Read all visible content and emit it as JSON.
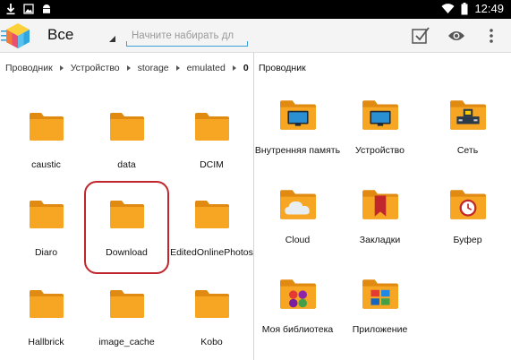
{
  "statusbar": {
    "time": "12:49",
    "left_icons": [
      "download-icon",
      "image-icon",
      "android-icon"
    ],
    "right_icons": [
      "wifi-icon",
      "battery-icon"
    ]
  },
  "actionbar": {
    "title": "Все",
    "search_placeholder": "Начните набирать дл",
    "actions": [
      "checkbox-icon",
      "eye-icon",
      "overflow-menu-icon"
    ]
  },
  "left_pane": {
    "breadcrumb": [
      "Проводник",
      "Устройство",
      "storage",
      "emulated",
      "0"
    ],
    "folders": [
      {
        "label": "caustic"
      },
      {
        "label": "data"
      },
      {
        "label": "DCIM"
      },
      {
        "label": "Diaro"
      },
      {
        "label": "Download"
      },
      {
        "label": "EditedOnlinePhotos"
      },
      {
        "label": "Hallbrick"
      },
      {
        "label": "image_cache"
      },
      {
        "label": "Kobo"
      }
    ]
  },
  "right_pane": {
    "title": "Проводник",
    "items": [
      {
        "label": "Внутренняя память",
        "icon": "monitor-folder-icon"
      },
      {
        "label": "Устройство",
        "icon": "monitor-folder-icon"
      },
      {
        "label": "Сеть",
        "icon": "network-folder-icon"
      },
      {
        "label": "Cloud",
        "icon": "cloud-folder-icon"
      },
      {
        "label": "Закладки",
        "icon": "bookmark-folder-icon"
      },
      {
        "label": "Буфер",
        "icon": "clock-folder-icon"
      },
      {
        "label": "Моя библиотека",
        "icon": "library-folder-icon"
      },
      {
        "label": "Приложение",
        "icon": "apps-folder-icon"
      }
    ]
  },
  "colors": {
    "folder": "#f6a623",
    "folder_dark": "#e08a12",
    "accent": "#3aa0d8",
    "highlight": "#c0262c"
  }
}
